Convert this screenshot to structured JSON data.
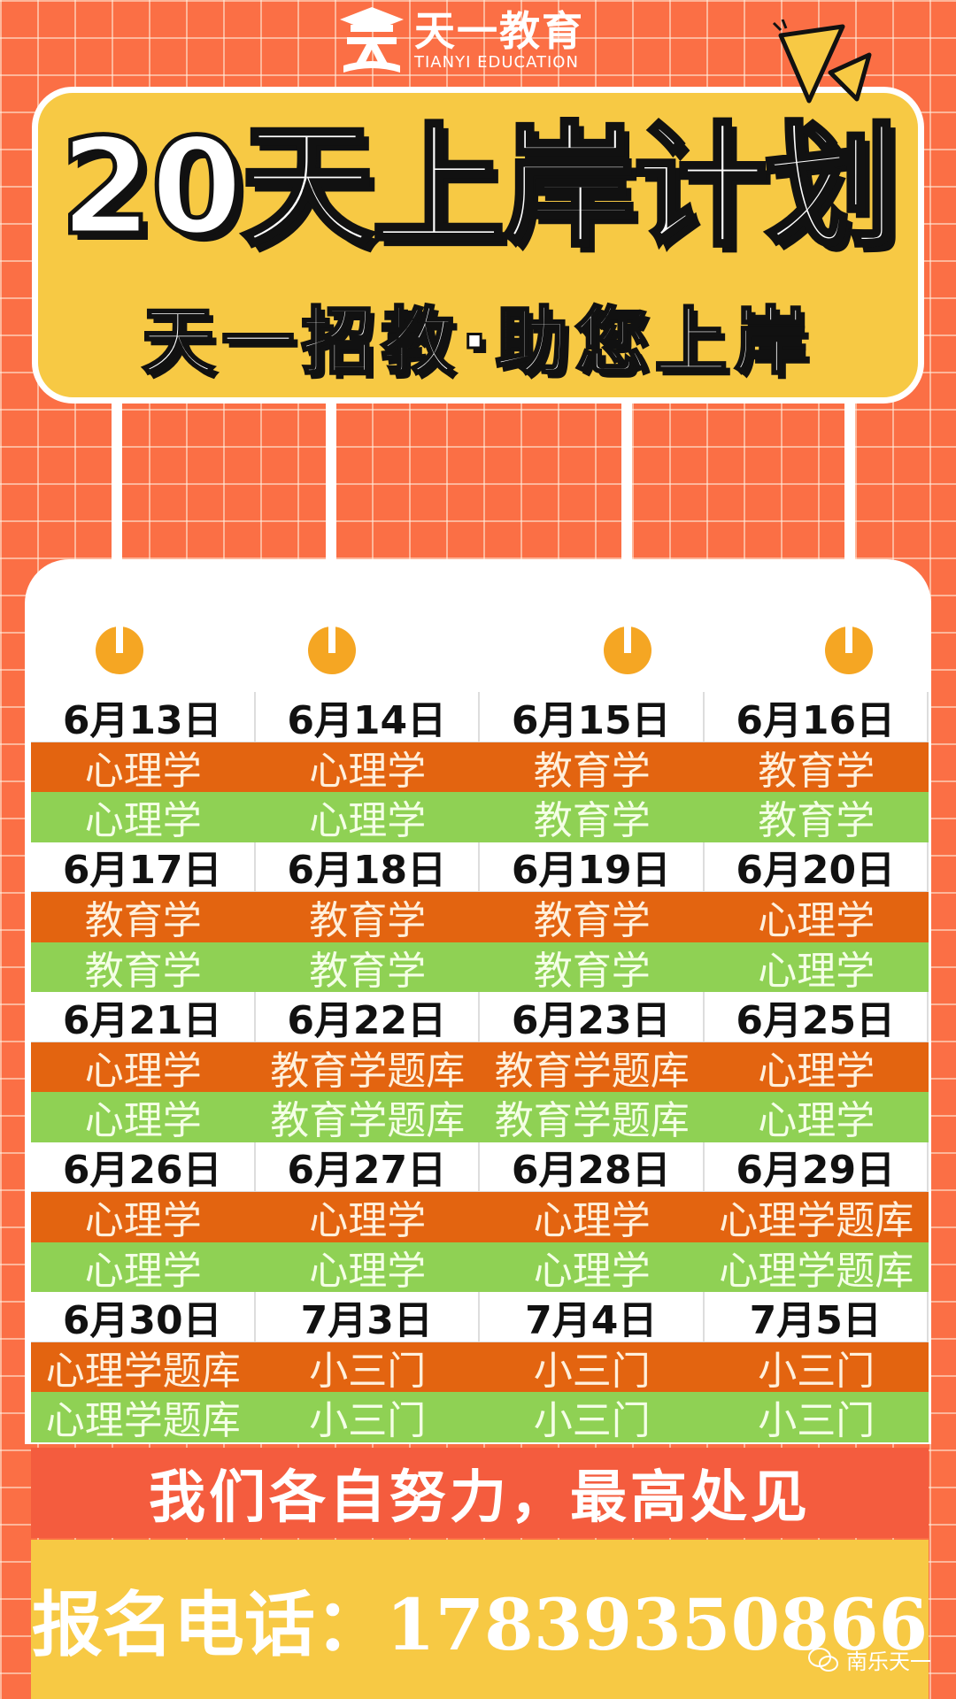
{
  "logo": {
    "name_cn": "天一教育",
    "name_en": "TIANYI EDUCATION"
  },
  "hero": {
    "title": "20天上岸计划",
    "subtitle": "天一招教·助您上岸"
  },
  "schedule": [
    {
      "dates": [
        "6月13日",
        "6月14日",
        "6月15日",
        "6月16日"
      ],
      "orange": [
        "心理学",
        "心理学",
        "教育学",
        "教育学"
      ],
      "green": [
        "心理学",
        "心理学",
        "教育学",
        "教育学"
      ]
    },
    {
      "dates": [
        "6月17日",
        "6月18日",
        "6月19日",
        "6月20日"
      ],
      "orange": [
        "教育学",
        "教育学",
        "教育学",
        "心理学"
      ],
      "green": [
        "教育学",
        "教育学",
        "教育学",
        "心理学"
      ]
    },
    {
      "dates": [
        "6月21日",
        "6月22日",
        "6月23日",
        "6月25日"
      ],
      "orange": [
        "心理学",
        "教育学题库",
        "教育学题库",
        "心理学"
      ],
      "green": [
        "心理学",
        "教育学题库",
        "教育学题库",
        "心理学"
      ]
    },
    {
      "dates": [
        "6月26日",
        "6月27日",
        "6月28日",
        "6月29日"
      ],
      "orange": [
        "心理学",
        "心理学",
        "心理学",
        "心理学题库"
      ],
      "green": [
        "心理学",
        "心理学",
        "心理学",
        "心理学题库"
      ]
    },
    {
      "dates": [
        "6月30日",
        "7月3日",
        "7月4日",
        "7月5日"
      ],
      "orange": [
        "心理学题库",
        "小三门",
        "小三门",
        "小三门"
      ],
      "green": [
        "心理学题库",
        "小三门",
        "小三门",
        "小三门"
      ]
    }
  ],
  "motto": "我们各自努力，最高处见",
  "phone": "报名电话：17839350866",
  "watermark": "南乐天一",
  "colors": {
    "background": "#fb6f45",
    "yellow": "#f7c944",
    "orange_row": "#e36410",
    "green_row": "#8fd154",
    "motto_bar": "#f45c3e",
    "ring": "#f5a623"
  }
}
